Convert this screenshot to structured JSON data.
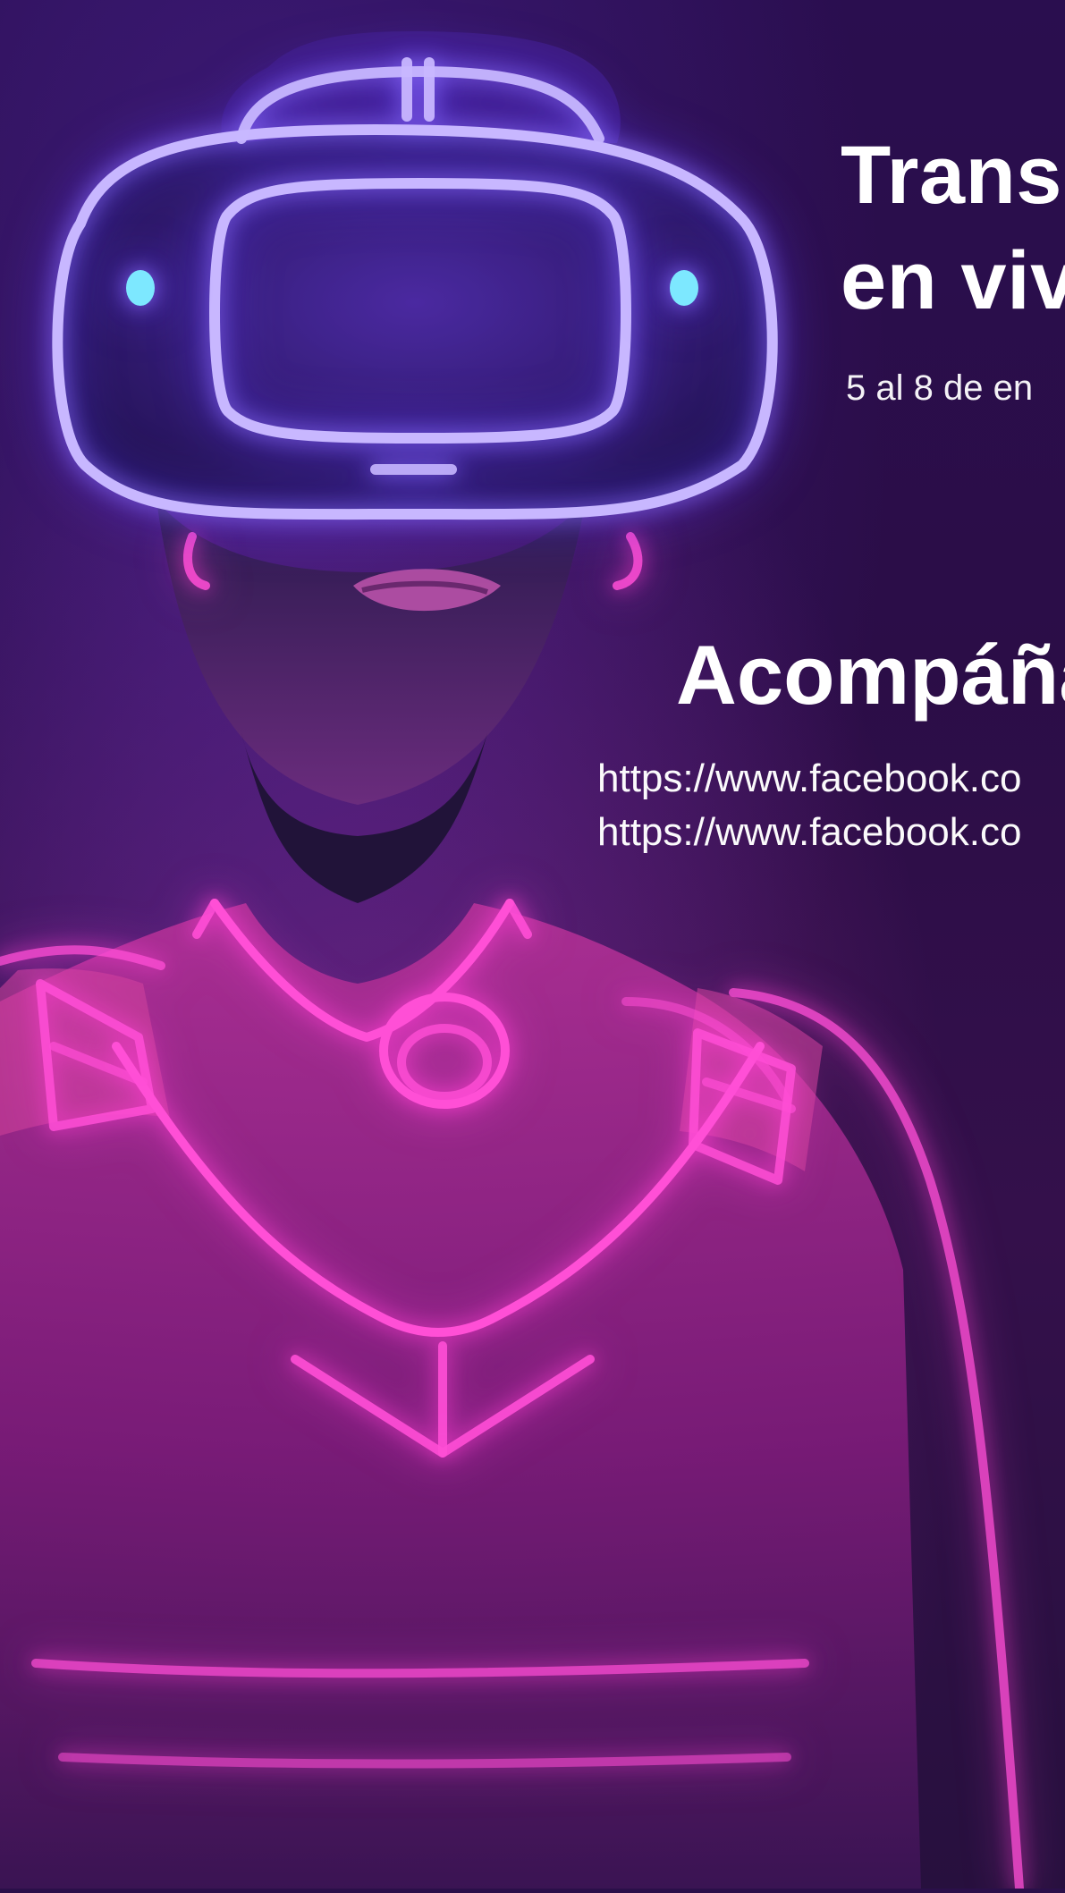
{
  "poster": {
    "title_line_1": "Transr",
    "title_line_2": "en viv",
    "date": "5 al 8 de en",
    "cta": "Acompáña",
    "links": [
      "https://www.facebook.co",
      "https://www.facebook.co"
    ]
  },
  "colors": {
    "background": "#2a0f49",
    "neon_pink": "#ff3fd6",
    "neon_blue": "#7e62ff",
    "text": "#ffffff"
  }
}
